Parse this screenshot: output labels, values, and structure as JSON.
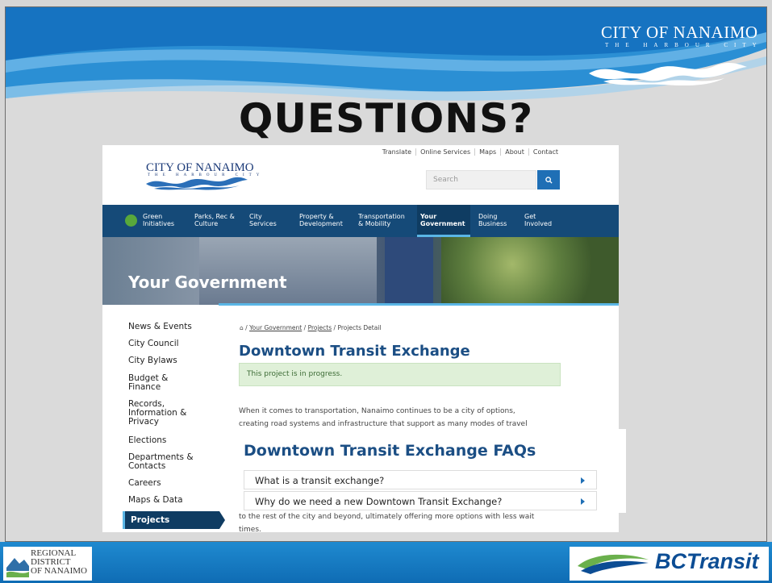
{
  "slide": {
    "title": "QUESTIONS?",
    "top_logo": {
      "name": "CITY OF NANAIMO",
      "tagline": "THE HARBOUR CITY"
    }
  },
  "website": {
    "logo": {
      "name": "CITY OF NANAIMO",
      "tagline": "THE HARBOUR CITY"
    },
    "utility_links": [
      "Translate",
      "Online Services",
      "Maps",
      "About",
      "Contact"
    ],
    "search": {
      "placeholder": "Search"
    },
    "nav": [
      {
        "label_1": "Green",
        "label_2": "Initiatives"
      },
      {
        "label_1": "Parks, Rec &",
        "label_2": "Culture"
      },
      {
        "label_1": "City",
        "label_2": "Services"
      },
      {
        "label_1": "Property &",
        "label_2": "Development"
      },
      {
        "label_1": "Transportation",
        "label_2": "& Mobility"
      },
      {
        "label_1": "Your",
        "label_2": "Government",
        "active": true
      },
      {
        "label_1": "Doing",
        "label_2": "Business"
      },
      {
        "label_1": "Get",
        "label_2": "Involved"
      }
    ],
    "hero_title": "Your Government",
    "sidebar": [
      {
        "label": "News & Events"
      },
      {
        "label": "City Council"
      },
      {
        "label": "City Bylaws"
      },
      {
        "label_1": "Budget &",
        "label_2": "Finance"
      },
      {
        "label_1": "Records,",
        "label_2": "Information &",
        "label_3": "Privacy"
      },
      {
        "label": "Elections"
      },
      {
        "label_1": "Departments &",
        "label_2": "Contacts"
      },
      {
        "label": "Careers"
      },
      {
        "label": "Maps & Data"
      },
      {
        "label": "Projects",
        "active": true
      }
    ],
    "breadcrumb": {
      "home_icon": "home-icon",
      "items": [
        "Your Government",
        "Projects",
        "Projects Detail"
      ],
      "sep": "/"
    },
    "page_title": "Downtown Transit Exchange",
    "status": "This project is in progress.",
    "intro_line_1": "When it comes to transportation, Nanaimo continues to be a city of options,",
    "intro_line_2": "creating road systems and infrastructure that support as many modes of travel",
    "faq": {
      "title": "Downtown Transit Exchange FAQs",
      "items": [
        "What is a transit exchange?",
        "Why do we need a new Downtown Transit Exchange?"
      ]
    },
    "tail_line_1": "to the rest of the city and beyond, ultimately offering more options with less wait",
    "tail_line_2": "times."
  },
  "footer": {
    "rdn": {
      "line_1": "REGIONAL",
      "line_2": "DISTRICT",
      "line_3": "OF NANAIMO"
    },
    "bctransit": "BCTransit"
  }
}
